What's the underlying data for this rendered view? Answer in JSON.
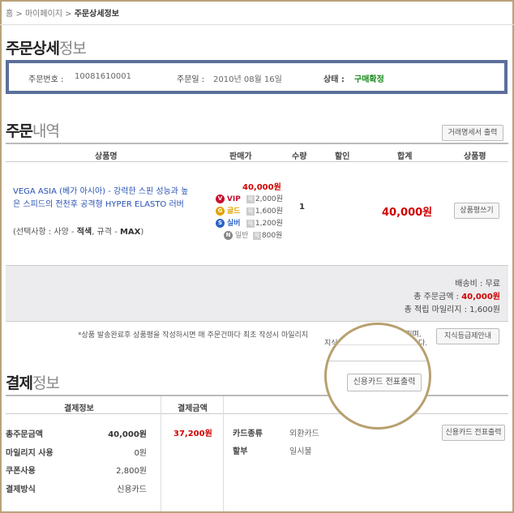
{
  "breadcrumb": {
    "home": "홈",
    "sep": ">",
    "mypage": "마이페이지",
    "current": "주문상세정보"
  },
  "title": {
    "dark": "주문상세",
    "light": "정보"
  },
  "order": {
    "no_label": "주문번호 :",
    "no": "10081610001",
    "date_label": "주문일 :",
    "date": "2010년 08월 16일",
    "status_label": "상태 :",
    "status": "구매확정"
  },
  "section_order": {
    "dark": "주문",
    "light": "내역",
    "print_btn": "거래명세서 출력"
  },
  "table": {
    "headers": [
      "상품명",
      "판매가",
      "수량",
      "할인",
      "합계",
      "상품평"
    ]
  },
  "item": {
    "name": "VEGA ASIA (베가 아시아) - 강력한 스핀 성능과 높은 스피드의 전천후 공격형 HYPER ELASTO 러버",
    "option_prefix": "(선택사항 : 사양 - ",
    "option_b1": "적색",
    "option_mid": ", 규격 - ",
    "option_b2": "MAX",
    "option_suffix": ")",
    "price": "40,000원",
    "grades": [
      {
        "badge": "V",
        "name": "VIP",
        "color": "#c8102e",
        "price": "2,000원"
      },
      {
        "badge": "G",
        "name": "골드",
        "color": "#e0a100",
        "price": "1,600원"
      },
      {
        "badge": "S",
        "name": "실버",
        "color": "#2a63c8",
        "price": "1,200원"
      },
      {
        "badge": "N",
        "name": "일반",
        "color": "#888888",
        "price": "800원"
      }
    ],
    "won_icon": "적",
    "qty": "1",
    "total": "40,000원",
    "review_btn": "상품평쓰기"
  },
  "summary": {
    "ship_label": "배송비 :",
    "ship": "무료",
    "total_label": "총 주문금액 :",
    "total": "40,000원",
    "mileage_label": "총 적립 마일리지 :",
    "mileage": "1,600원"
  },
  "notice": {
    "line1": "*상품 발송완료후 상품평을 작성하시면 매 주문건마다 최초 작성시 마일리지 ",
    "frag1": "드리며,",
    "frag2": "지식",
    "frag3": "다.",
    "btn": "지식등급제안내"
  },
  "section_pay": {
    "dark": "결제",
    "light": "정보"
  },
  "magnifier_btn": "신용카드 전표출력",
  "pay_table": {
    "headers": [
      "결제정보",
      "결제금액"
    ],
    "rows": [
      {
        "label": "총주문금액",
        "value": "40,000원"
      },
      {
        "label": "마일리지 사용",
        "value": "0원"
      },
      {
        "label": "쿠폰사용",
        "value": "2,800원"
      },
      {
        "label": "결제방식",
        "value": "신용카드"
      }
    ],
    "amount": "37,200원",
    "card_label": "카드종류",
    "card": "외환카드",
    "inst_label": "할부",
    "inst": "일시불",
    "receipt_btn": "신용카드 전표출력"
  }
}
